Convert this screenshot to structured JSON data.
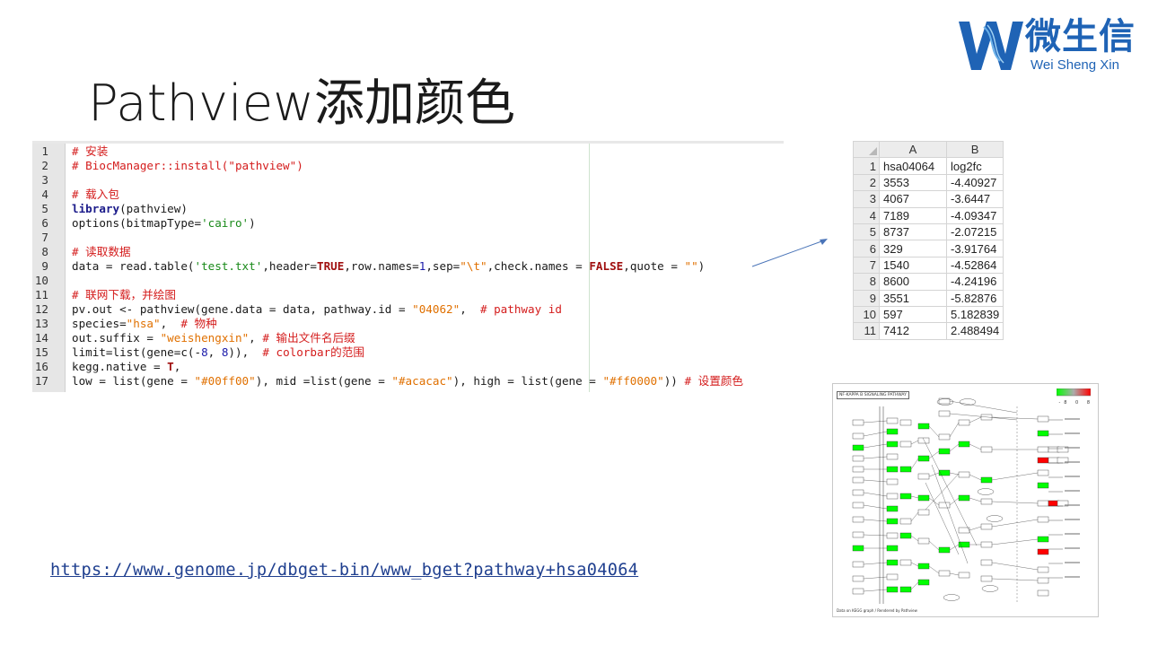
{
  "slide": {
    "title": "Pathview添加颜色"
  },
  "logo": {
    "chinese": "微生信",
    "english": "Wei Sheng Xin",
    "color": "#1f63b5"
  },
  "code": {
    "line_numbers": [
      "1",
      "2",
      "3",
      "4",
      "5",
      "6",
      "7",
      "8",
      "9",
      "10",
      "11",
      "12",
      "13",
      "14",
      "15",
      "16",
      "17"
    ],
    "colors": {
      "comment": "#d41c1c",
      "keyword": "#1a1a8a",
      "string": "#e07000"
    }
  },
  "spreadsheet": {
    "columns": [
      "A",
      "B"
    ],
    "rows": [
      {
        "n": "1",
        "a": "hsa04064",
        "b": "log2fc"
      },
      {
        "n": "2",
        "a": "3553",
        "b": "-4.40927"
      },
      {
        "n": "3",
        "a": "4067",
        "b": "-3.6447"
      },
      {
        "n": "4",
        "a": "7189",
        "b": "-4.09347"
      },
      {
        "n": "5",
        "a": "8737",
        "b": "-2.07215"
      },
      {
        "n": "6",
        "a": "329",
        "b": "-3.91764"
      },
      {
        "n": "7",
        "a": "1540",
        "b": "-4.52864"
      },
      {
        "n": "8",
        "a": "8600",
        "b": "-4.24196"
      },
      {
        "n": "9",
        "a": "3551",
        "b": "-5.82876"
      },
      {
        "n": "10",
        "a": "597",
        "b": "5.182839"
      },
      {
        "n": "11",
        "a": "7412",
        "b": "2.488494"
      }
    ]
  },
  "link": {
    "url": "https://www.genome.jp/dbget-bin/www_bget?pathway+hsa04064"
  },
  "pathway_image": {
    "title": "NF-KAPPA B SIGNALING PATHWAY",
    "legend": "-8   0   8",
    "footer": "Data on KEGG graph / Rendered by Pathview",
    "up_color": "#ff0000",
    "down_color": "#00ff00",
    "mid_color": "#acacac"
  }
}
